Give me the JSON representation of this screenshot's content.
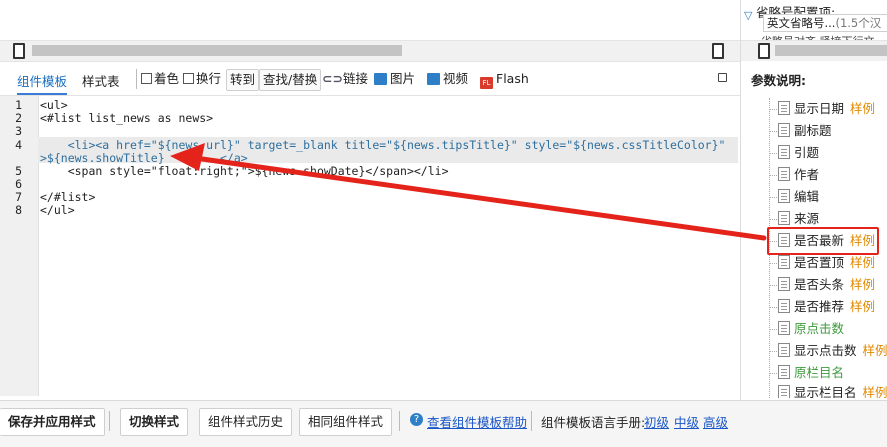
{
  "config_panel": {
    "title": "省略号配置项:",
    "input_value": "英文省略号...",
    "input_hint": "(1.5个汉",
    "sub_text": "省略号对齐,紧接下行文"
  },
  "tabs": {
    "template": "组件模板",
    "style": "样式表"
  },
  "toolbar": {
    "color": "着色",
    "wrap": "换行",
    "goto": "转到",
    "find_replace": "查找/替换",
    "link": "链接",
    "image": "图片",
    "video": "视频",
    "flash": "Flash"
  },
  "editor": {
    "line_numbers": [
      "1",
      "2",
      "3",
      "4",
      "",
      "5",
      "6",
      "7",
      "8"
    ],
    "lines": [
      "<ul>",
      "<#list list_news as news>",
      "",
      "    <li><a href=\"${news.url}\" target=_blank title=\"${news.tipsTitle}\" style=\"${news.cssTitleColor}\"",
      ">${news.showTitle}        </a>",
      "    <span style=\"float:right;\">${news.showDate}</span></li>",
      "",
      "</#list>",
      "</ul>"
    ]
  },
  "params": {
    "heading": "参数说明:",
    "example_label": "样例",
    "items": [
      {
        "label": "显示日期",
        "example": "样例"
      },
      {
        "label": "副标题",
        "example": ""
      },
      {
        "label": "引题",
        "example": ""
      },
      {
        "label": "作者",
        "example": ""
      },
      {
        "label": "编辑",
        "example": ""
      },
      {
        "label": "来源",
        "example": ""
      },
      {
        "label": "是否最新",
        "example": "样例"
      },
      {
        "label": "是否置顶",
        "example": "样例"
      },
      {
        "label": "是否头条",
        "example": "样例"
      },
      {
        "label": "是否推荐",
        "example": "样例"
      },
      {
        "label": "原点击数",
        "example": ""
      },
      {
        "label": "显示点击数",
        "example": "样例"
      },
      {
        "label": "原栏目名",
        "example": ""
      },
      {
        "label": "显示栏目名",
        "example": "样例"
      }
    ]
  },
  "bottom": {
    "save_apply": "保存并应用样式",
    "switch_style": "切换样式",
    "history": "组件样式历史",
    "same_style": "相同组件样式",
    "help_link": "查看组件模板帮助",
    "manual_label": "组件模板语言手册:",
    "level_basic": "初级",
    "level_mid": "中级",
    "level_adv": "高级"
  },
  "colors": {
    "accent_blue": "#1a6fbf",
    "example_orange": "#e28a00",
    "annotation_red": "#e4231a",
    "green_item": "#3c9a3c"
  }
}
